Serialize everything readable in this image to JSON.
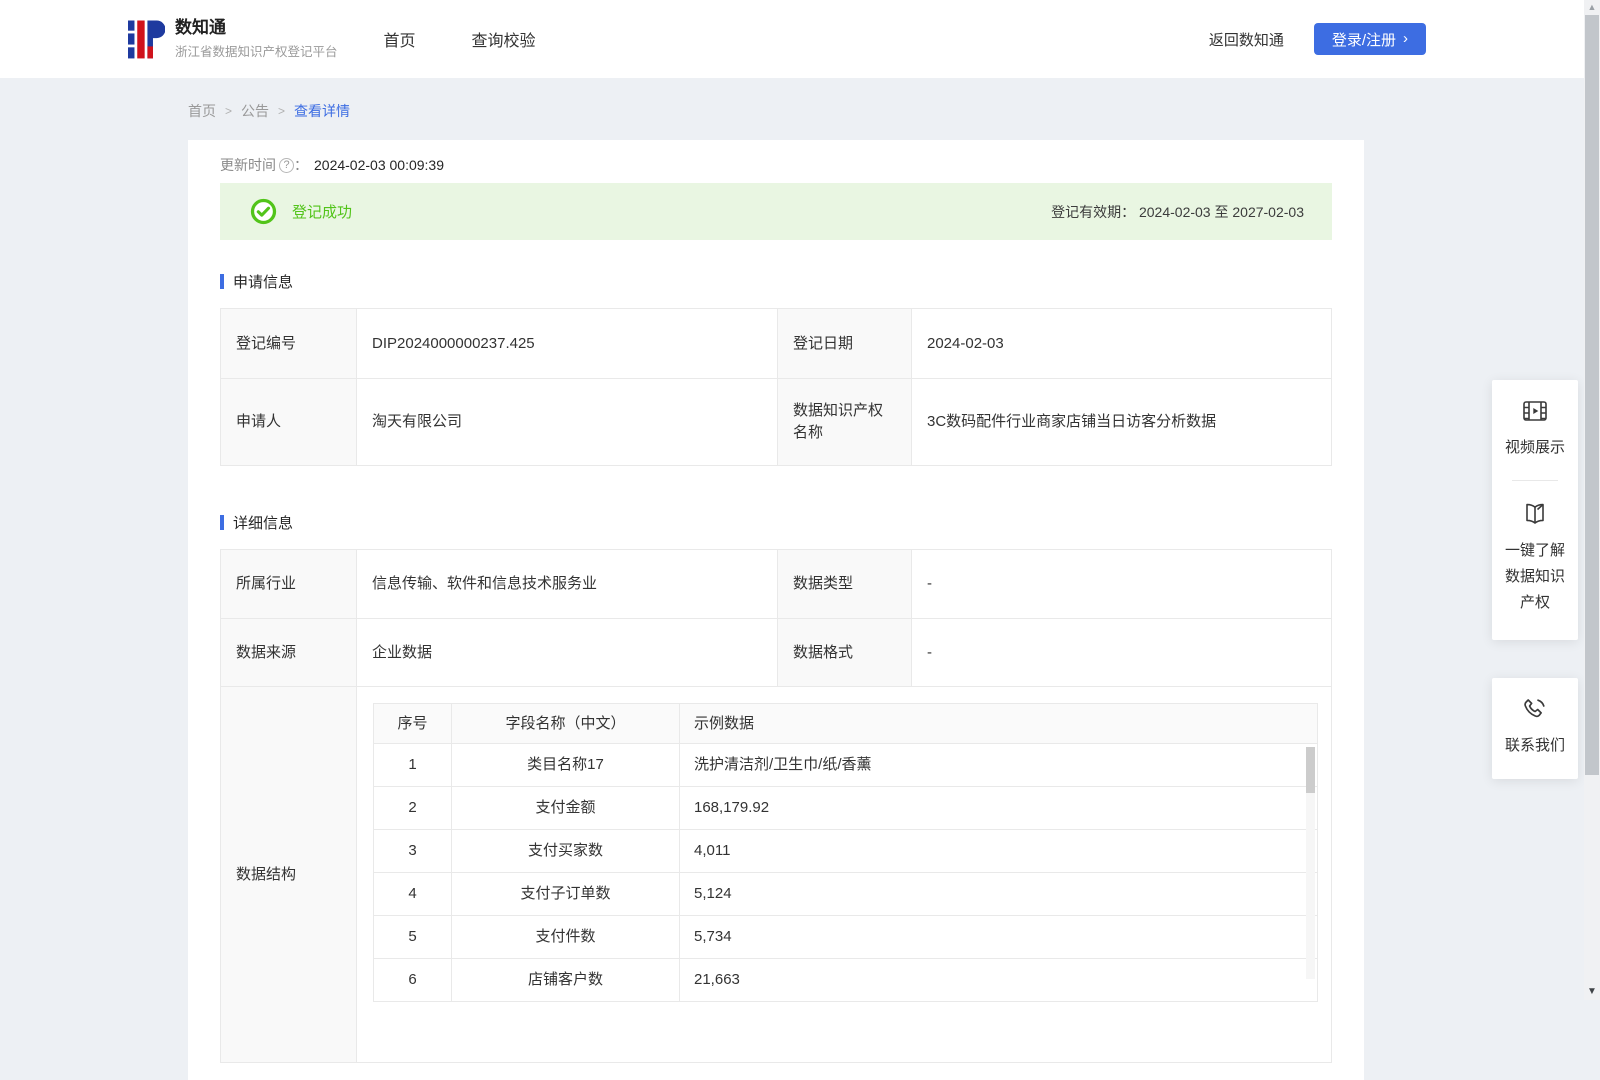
{
  "colors": {
    "accent_blue": "#3d6de2",
    "success_green": "#52c41a",
    "success_banner_bg": "#e9f6e2",
    "logo_blue": "#1e3a9f",
    "logo_red": "#d0121b",
    "page_bg": "#edf0f4"
  },
  "icons": {
    "help": "?",
    "chevron_right": "›",
    "breadcrumb_sep": ">",
    "arrow_up": "▲",
    "arrow_down": "▼"
  },
  "header": {
    "logo_title": "数知通",
    "logo_subtitle": "浙江省数据知识产权登记平台",
    "nav": [
      {
        "label": "首页"
      },
      {
        "label": "查询校验"
      }
    ],
    "back_link": "返回数知通",
    "login_button": "登录/注册"
  },
  "breadcrumb": {
    "items": [
      {
        "label": "首页"
      },
      {
        "label": "公告"
      },
      {
        "label": "查看详情"
      }
    ]
  },
  "detail": {
    "update_time_label": "更新时间",
    "update_time_colon": "：",
    "update_time": "2024-02-03 00:09:39",
    "status_banner": {
      "status_text": "登记成功",
      "validity_label": "登记有效期：",
      "validity_value": "2024-02-03 至 2027-02-03"
    },
    "apply_section": {
      "title": "申请信息",
      "rows": [
        {
          "label1": "登记编号",
          "value1": "DIP2024000000237.425",
          "label2": "登记日期",
          "value2": "2024-02-03"
        },
        {
          "label1": "申请人",
          "value1": "淘天有限公司",
          "label2": "数据知识产权名称",
          "value2": "3C数码配件行业商家店铺当日访客分析数据"
        }
      ]
    },
    "detail_section": {
      "title": "详细信息",
      "rows": [
        {
          "label1": "所属行业",
          "value1": "信息传输、软件和信息技术服务业",
          "label2": "数据类型",
          "value2": "-"
        },
        {
          "label1": "数据来源",
          "value1": "企业数据",
          "label2": "数据格式",
          "value2": "-"
        }
      ],
      "structure_label": "数据结构",
      "structure_table": {
        "headers": [
          "序号",
          "字段名称（中文）",
          "示例数据"
        ],
        "rows": [
          [
            "1",
            "类目名称17",
            "洗护清洁剂/卫生巾/纸/香薰"
          ],
          [
            "2",
            "支付金额",
            "168,179.92"
          ],
          [
            "3",
            "支付买家数",
            "4,011"
          ],
          [
            "4",
            "支付子订单数",
            "5,124"
          ],
          [
            "5",
            "支付件数",
            "5,734"
          ],
          [
            "6",
            "店铺客户数",
            "21,663"
          ]
        ]
      }
    }
  },
  "floating_widgets": {
    "video_label": "视频展示",
    "guide_lines": [
      "一键了解",
      "数据知识",
      "产权"
    ],
    "contact_label": "联系我们"
  }
}
